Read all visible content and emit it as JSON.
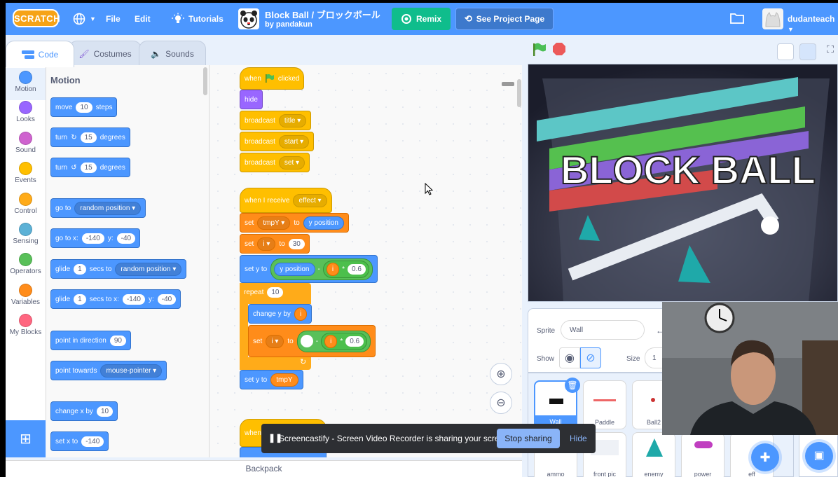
{
  "menubar": {
    "logo": "SCRATCH",
    "file": "File",
    "edit": "Edit",
    "tutorials": "Tutorials",
    "project_title": "Block Ball / ブロックボール",
    "author": "by pandakun",
    "remix": "Remix",
    "see_project": "See Project Page",
    "username": "dudanteach"
  },
  "tabs": {
    "code": "Code",
    "costumes": "Costumes",
    "sounds": "Sounds"
  },
  "categories": [
    {
      "label": "Motion",
      "color": "#4c97ff"
    },
    {
      "label": "Looks",
      "color": "#9966ff"
    },
    {
      "label": "Sound",
      "color": "#cf63cf"
    },
    {
      "label": "Events",
      "color": "#ffbf00"
    },
    {
      "label": "Control",
      "color": "#ffab19"
    },
    {
      "label": "Sensing",
      "color": "#5cb1d6"
    },
    {
      "label": "Operators",
      "color": "#59c059"
    },
    {
      "label": "Variables",
      "color": "#ff8c1a"
    },
    {
      "label": "My Blocks",
      "color": "#ff6680"
    }
  ],
  "palette": {
    "title": "Motion",
    "move": {
      "a": "move",
      "v": "10",
      "b": "steps"
    },
    "turn_right": {
      "a": "turn",
      "v": "15",
      "b": "degrees"
    },
    "turn_left": {
      "a": "turn",
      "v": "15",
      "b": "degrees"
    },
    "goto": {
      "a": "go to",
      "d": "random position"
    },
    "gotoxy": {
      "a": "go to x:",
      "x": "-140",
      "b": "y:",
      "y": "-40"
    },
    "glide": {
      "a": "glide",
      "v": "1",
      "b": "secs to",
      "d": "random position"
    },
    "glidexy": {
      "a": "glide",
      "v": "1",
      "b": "secs to x:",
      "x": "-140",
      "c": "y:",
      "y": "-40"
    },
    "point_dir": {
      "a": "point in direction",
      "v": "90"
    },
    "point_towards": {
      "a": "point towards",
      "d": "mouse-pointer"
    },
    "change_x": {
      "a": "change x by",
      "v": "10"
    },
    "set_x": {
      "a": "set x to",
      "v": "-140"
    }
  },
  "script1": {
    "when": "when",
    "clicked": "clicked",
    "hide": "hide",
    "bc1": {
      "a": "broadcast",
      "d": "title"
    },
    "bc2": {
      "a": "broadcast",
      "d": "start"
    },
    "bc3": {
      "a": "broadcast",
      "d": "set"
    }
  },
  "script2": {
    "receive": {
      "a": "when I receive",
      "d": "effect"
    },
    "set1": {
      "a": "set",
      "d": "tmpY",
      "b": "to",
      "r": "y position"
    },
    "set2": {
      "a": "set",
      "d": "i",
      "b": "to",
      "v": "30"
    },
    "sety": {
      "a": "set y to",
      "r": "y position",
      "op": "-",
      "i": "i",
      "m": "*",
      "v": "0.6"
    },
    "repeat": {
      "a": "repeat",
      "v": "10"
    },
    "changey": {
      "a": "change y by",
      "i": "i"
    },
    "set3": {
      "a": "set",
      "d": "i",
      "b": "to",
      "op": "-",
      "i": "i",
      "m": "*",
      "v": "0.6"
    },
    "sety2": {
      "a": "set y to",
      "r": "tmpY"
    },
    "when_partial": "when"
  },
  "backpack": "Backpack",
  "stage_title": "BLOCK BALL",
  "sprite_info": {
    "sprite_label": "Sprite",
    "sprite_name": "Wall",
    "show_label": "Show",
    "size_label": "Size",
    "size_value": "1"
  },
  "sprites": [
    "Wall",
    "Paddle",
    "Ball2",
    "ammo",
    "front pic",
    "enemy",
    "power",
    "eff"
  ],
  "notification": {
    "text": "Screencastify - Screen Video Recorder is sharing your screen.",
    "stop": "Stop sharing",
    "hide": "Hide"
  },
  "zoom": {
    "in": "+",
    "out": "−"
  }
}
